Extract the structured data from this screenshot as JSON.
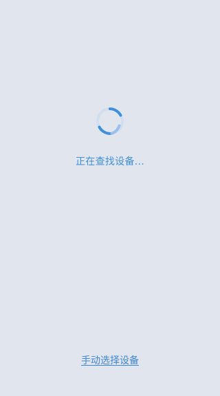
{
  "status": {
    "text": "正在查找设备..."
  },
  "actions": {
    "manual_select_label": "手动选择设备"
  },
  "loading_indicator": {
    "icon": "loading-spinner-icon",
    "color": "#3f8fdc",
    "track_color": "#c9daf0"
  },
  "theme": {
    "background": "#e1e6ee",
    "accent": "#3f8fdc",
    "link": "#3f86d8"
  }
}
